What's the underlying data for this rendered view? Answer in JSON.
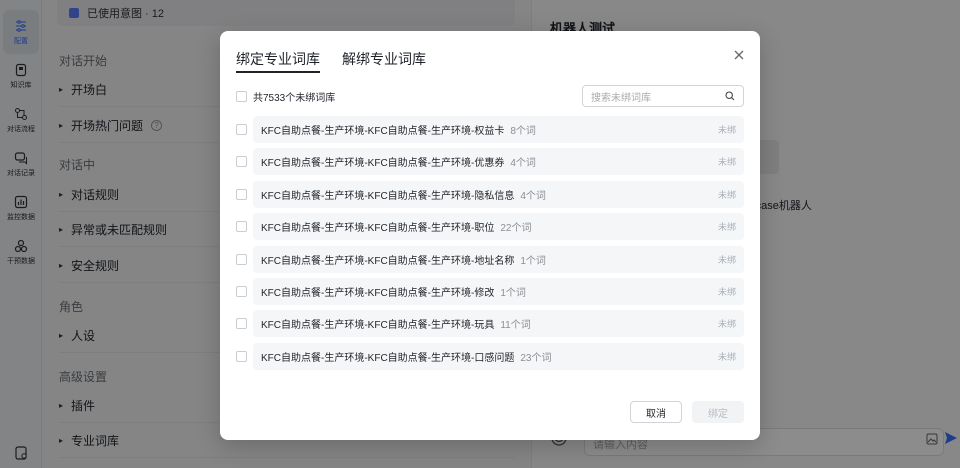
{
  "sidebar": {
    "items": [
      {
        "label": "配置",
        "icon": "sliders-icon",
        "active": true
      },
      {
        "label": "知识库",
        "icon": "book-icon"
      },
      {
        "label": "对话流程",
        "icon": "flow-icon"
      },
      {
        "label": "对话记录",
        "icon": "chat-icon"
      },
      {
        "label": "监控数据",
        "icon": "monitor-chart-icon"
      },
      {
        "label": "干预数据",
        "icon": "intervene-icon"
      }
    ]
  },
  "config": {
    "top_card": "已使用意图 · 12",
    "sections": [
      {
        "title": "对话开始",
        "rows": [
          "开场白",
          "开场热门问题"
        ]
      },
      {
        "title": "对话中",
        "rows": [
          "对话规则",
          "异常或未匹配规则",
          "安全规则"
        ]
      },
      {
        "title": "角色",
        "rows": [
          "人设"
        ]
      },
      {
        "title": "高级设置",
        "rows": [
          "插件",
          "专业词库"
        ]
      }
    ]
  },
  "robot": {
    "title": "机器人测试",
    "name_fragment": "rcase机器人",
    "input_placeholder": "请输入内容"
  },
  "modal": {
    "tabs": [
      "绑定专业词库",
      "解绑专业词库"
    ],
    "active_tab": 0,
    "select_all_label": "共7533个未绑词库",
    "search_placeholder": "搜索未绑词库",
    "items": [
      {
        "name": "KFC自助点餐-生产环境-KFC自助点餐-生产环境-权益卡",
        "count": "8个词",
        "status": "未绑"
      },
      {
        "name": "KFC自助点餐-生产环境-KFC自助点餐-生产环境-优惠券",
        "count": "4个词",
        "status": "未绑"
      },
      {
        "name": "KFC自助点餐-生产环境-KFC自助点餐-生产环境-隐私信息",
        "count": "4个词",
        "status": "未绑"
      },
      {
        "name": "KFC自助点餐-生产环境-KFC自助点餐-生产环境-职位",
        "count": "22个词",
        "status": "未绑"
      },
      {
        "name": "KFC自助点餐-生产环境-KFC自助点餐-生产环境-地址名称",
        "count": "1个词",
        "status": "未绑"
      },
      {
        "name": "KFC自助点餐-生产环境-KFC自助点餐-生产环境-修改",
        "count": "1个词",
        "status": "未绑"
      },
      {
        "name": "KFC自助点餐-生产环境-KFC自助点餐-生产环境-玩具",
        "count": "11个词",
        "status": "未绑"
      },
      {
        "name": "KFC自助点餐-生产环境-KFC自助点餐-生产环境-口感问题",
        "count": "23个词",
        "status": "未绑"
      }
    ],
    "cancel_label": "取消",
    "bind_label": "绑定"
  }
}
